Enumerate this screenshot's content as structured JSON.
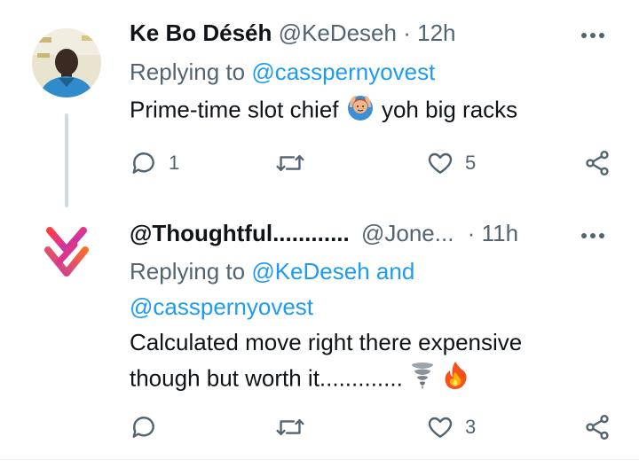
{
  "tweets": [
    {
      "display_name": "Ke Bo Déséh",
      "handle": "@KeDeseh",
      "separator": "·",
      "time": "12h",
      "replying_prefix": "Replying to",
      "replying_to": "@casspernyovest",
      "text_before_emoji": "Prime-time slot chief",
      "emoji": "person-gesturing-ok-emoji",
      "text_after_emoji": "yoh big racks",
      "reply_count": "1",
      "retweet_count": "",
      "like_count": "5"
    },
    {
      "display_name": "@Thoughtful............",
      "handle": "@Jone...",
      "separator": "·",
      "time": "11h",
      "replying_prefix": "Replying to",
      "replying_to_1": "@KeDeseh",
      "replying_and": "and",
      "replying_to_2": "@casspernyovest",
      "text_line1": "Calculated move right there expensive",
      "text_line2": "though but worth it.............",
      "emojis": [
        "tornado-emoji",
        "fire-emoji"
      ],
      "reply_count": "",
      "retweet_count": "",
      "like_count": "3"
    }
  ],
  "icons": {
    "reply": "reply-icon",
    "retweet": "retweet-icon",
    "like": "heart-icon",
    "share": "share-icon",
    "more": "more-options-icon"
  },
  "colors": {
    "accent": "#1d9bf0",
    "muted": "#536471",
    "text": "#0f1419",
    "thread_line": "#cfd9de"
  }
}
